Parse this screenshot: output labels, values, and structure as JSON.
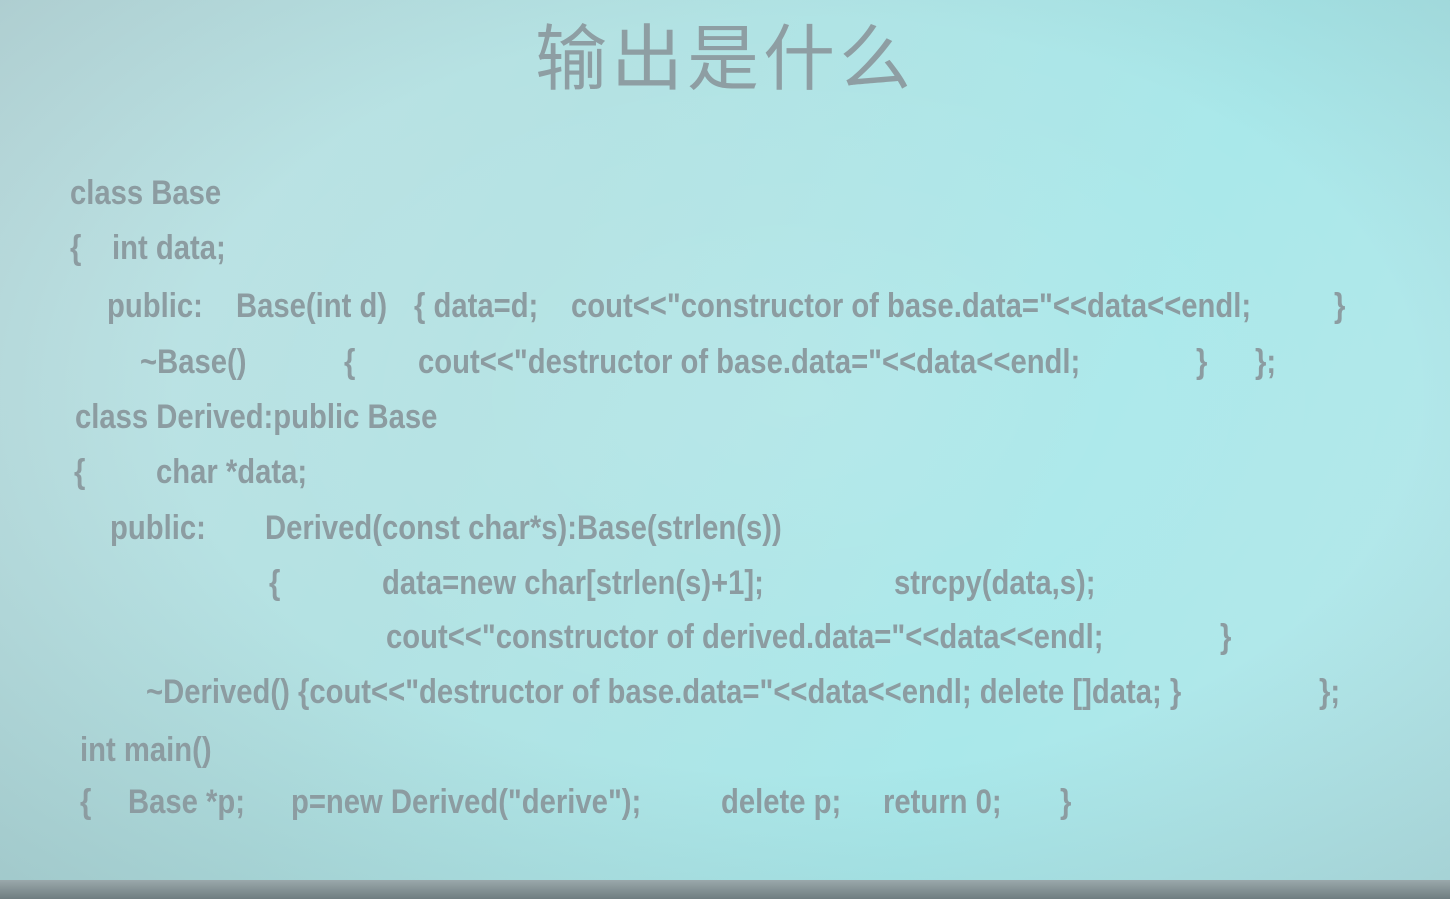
{
  "slide": {
    "title": "输出是什么",
    "code_lines": [
      [
        "class Base"
      ],
      [
        "{",
        "int data;"
      ],
      [
        "public:",
        "Base(int d)",
        "{ data=d;",
        "cout<<\"constructor of base.data=\"<<data<<endl;",
        "}"
      ],
      [
        "~Base()",
        "{",
        "cout<<\"destructor of base.data=\"<<data<<endl;",
        "}",
        "};"
      ],
      [
        "class Derived:public Base"
      ],
      [
        "{",
        "char *data;"
      ],
      [
        "public:",
        "Derived(const char*s):Base(strlen(s))"
      ],
      [
        "{",
        "data=new char[strlen(s)+1];",
        "strcpy(data,s);"
      ],
      [
        "cout<<\"constructor of derived.data=\"<<data<<endl;",
        "}"
      ],
      [
        "~Derived() {cout<<\"destructor of base.data=\"<<data<<endl; delete []data; }",
        "};"
      ],
      [
        "int main()"
      ],
      [
        "{",
        "Base *p;",
        "p=new Derived(\"derive\");",
        "delete p;",
        "return 0;",
        "}"
      ]
    ]
  }
}
